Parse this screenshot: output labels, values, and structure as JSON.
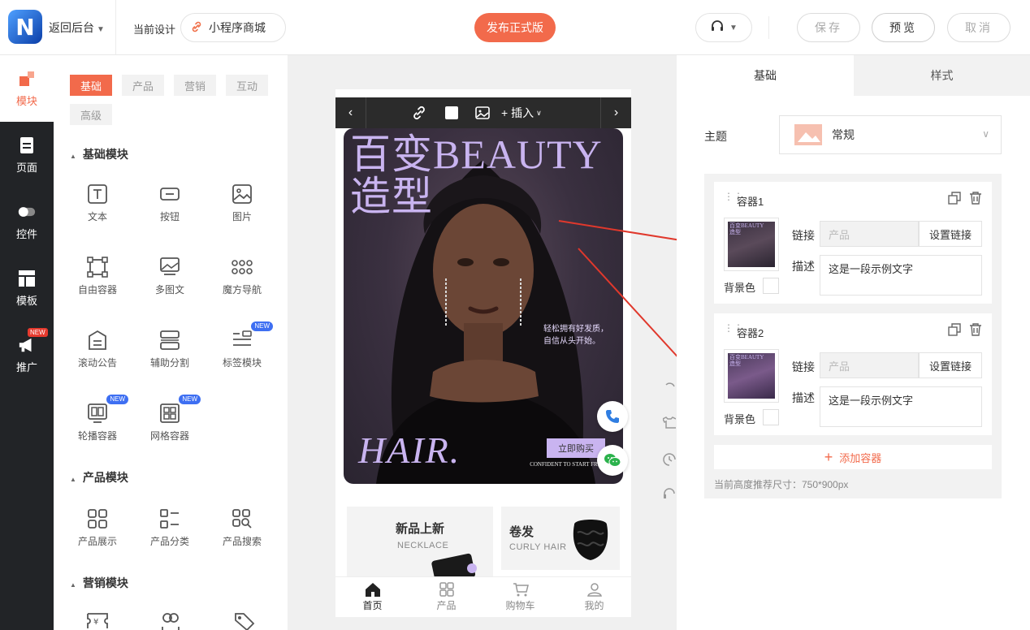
{
  "topbar": {
    "logo_letter": "N",
    "back_label": "返回后台",
    "current_design_label": "当前设计",
    "design_name": "小程序商城",
    "publish_label": "发布正式版",
    "save_label": "保存",
    "preview_label": "预览",
    "cancel_label": "取消"
  },
  "rail": {
    "items": [
      {
        "label": "模块",
        "icon": "module-icon",
        "active": true
      },
      {
        "label": "页面",
        "icon": "page-icon"
      },
      {
        "label": "控件",
        "icon": "toggle-icon"
      },
      {
        "label": "模板",
        "icon": "template-icon"
      },
      {
        "label": "推广",
        "icon": "megaphone-icon",
        "badge": "NEW"
      }
    ]
  },
  "panel": {
    "tabs": [
      "基础",
      "产品",
      "营销",
      "互动",
      "高级"
    ],
    "active_tab": "基础",
    "sections": [
      {
        "title": "基础模块",
        "items": [
          {
            "label": "文本",
            "icon": "text-icon"
          },
          {
            "label": "按钮",
            "icon": "button-icon"
          },
          {
            "label": "图片",
            "icon": "image-icon"
          },
          {
            "label": "自由容器",
            "icon": "free-container-icon"
          },
          {
            "label": "多图文",
            "icon": "multi-image-icon"
          },
          {
            "label": "魔方导航",
            "icon": "grid-dots-icon"
          },
          {
            "label": "滚动公告",
            "icon": "notice-icon"
          },
          {
            "label": "辅助分割",
            "icon": "divider-icon"
          },
          {
            "label": "标签模块",
            "icon": "tag-list-icon",
            "badge": "NEW"
          },
          {
            "label": "轮播容器",
            "icon": "carousel-icon",
            "badge": "NEW"
          },
          {
            "label": "网格容器",
            "icon": "grid-container-icon",
            "badge": "NEW"
          }
        ]
      },
      {
        "title": "产品模块",
        "items": [
          {
            "label": "产品展示",
            "icon": "product-grid-icon"
          },
          {
            "label": "产品分类",
            "icon": "category-icon"
          },
          {
            "label": "产品搜索",
            "icon": "product-search-icon"
          }
        ]
      },
      {
        "title": "营销模块",
        "items": []
      }
    ]
  },
  "phone": {
    "toolbar": {
      "insert_label": "+ 插入"
    },
    "banner": {
      "title_line1": "百变BEAUTY",
      "title_line2": "造型",
      "subtitle_line1": "轻松拥有好发质，",
      "subtitle_line2": "自信从头开始。",
      "hair": "HAIR.",
      "buy_label": "立即购买",
      "small_text": "CONFIDENT TO START FROM SCRA"
    },
    "cards": [
      {
        "title": "新品上新",
        "sub": "NECKLACE"
      },
      {
        "title": "卷发",
        "sub": "CURLY HAIR"
      }
    ],
    "tabbar": [
      {
        "label": "首页",
        "icon": "home-icon",
        "active": true
      },
      {
        "label": "产品",
        "icon": "product-icon"
      },
      {
        "label": "购物车",
        "icon": "cart-icon"
      },
      {
        "label": "我的",
        "icon": "user-icon"
      }
    ]
  },
  "right": {
    "tabs": [
      "基础",
      "样式"
    ],
    "theme_label": "主题",
    "theme_value": "常规",
    "containers": [
      {
        "title": "容器1",
        "link_label": "链接",
        "link_placeholder": "产品",
        "set_link": "设置链接",
        "desc_label": "描述",
        "desc_value": "这是一段示例文字",
        "bg_label": "背景色"
      },
      {
        "title": "容器2",
        "link_label": "链接",
        "link_placeholder": "产品",
        "set_link": "设置链接",
        "desc_label": "描述",
        "desc_value": "这是一段示例文字",
        "bg_label": "背景色"
      }
    ],
    "add_container": "添加容器",
    "recommend_size": "当前高度推荐尺寸：750*900px"
  },
  "colors": {
    "accent": "#f26a4b",
    "rail": "#222427",
    "banner_text": "#c9b4f0",
    "arrow": "#e0382c"
  }
}
